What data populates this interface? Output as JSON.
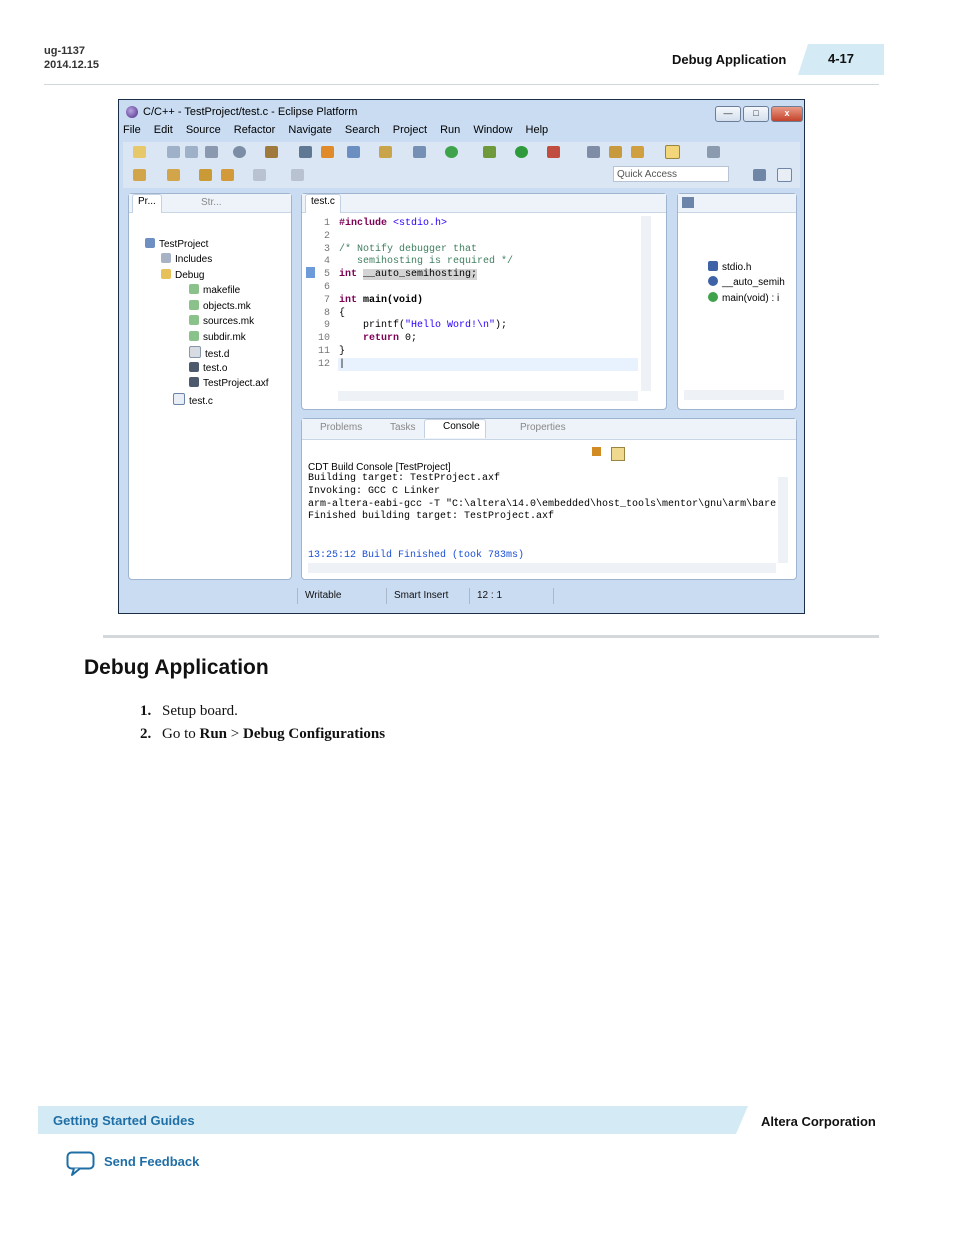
{
  "header": {
    "doc_id": "ug-1137",
    "date": "2014.12.15",
    "section": "Debug Application",
    "page": "4-17"
  },
  "eclipse": {
    "title": "C/C++ - TestProject/test.c - Eclipse Platform",
    "buttons": {
      "minimize": "—",
      "maximize": "□",
      "close": "x"
    },
    "menu": [
      "File",
      "Edit",
      "Source",
      "Refactor",
      "Navigate",
      "Search",
      "Project",
      "Run",
      "Window",
      "Help"
    ],
    "quick_access": "Quick Access",
    "project_tabs": [
      "Pr...",
      "Str..."
    ],
    "tree": [
      {
        "label": "TestProject"
      },
      {
        "label": "Includes"
      },
      {
        "label": "Debug"
      },
      {
        "label": "makefile"
      },
      {
        "label": "objects.mk"
      },
      {
        "label": "sources.mk"
      },
      {
        "label": "subdir.mk"
      },
      {
        "label": "test.d"
      },
      {
        "label": "test.o"
      },
      {
        "label": "TestProject.axf"
      },
      {
        "label": "test.c"
      }
    ],
    "editor_tab": "test.c",
    "code": {
      "l1_kw": "#include",
      "l1_str": "<stdio.h>",
      "l3": "/* Notify debugger that",
      "l4": "   semihosting is required */",
      "l5_kw": "int",
      "l5_rest": "__auto_semihosting;",
      "l7_kw": "int",
      "l7_rest": "main(void)",
      "l8": "{",
      "l9_a": "    printf(",
      "l9_str": "\"Hello Word!\\n\"",
      "l9_b": ");",
      "l10_kw": "    return",
      "l10_rest": " 0;",
      "l11": "}"
    },
    "line_numbers": [
      "1",
      "2",
      "3",
      "4",
      "5",
      "6",
      "7",
      "8",
      "9",
      "10",
      "11",
      "12"
    ],
    "outline": [
      "stdio.h",
      "__auto_semih",
      "main(void) : i"
    ],
    "bottom_tabs": [
      "Problems",
      "Tasks",
      "Console",
      "Properties"
    ],
    "console_title": "CDT Build Console [TestProject]",
    "console_lines": [
      "Building target: TestProject.axf",
      "Invoking: GCC C Linker",
      "arm-altera-eabi-gcc -T \"C:\\altera\\14.0\\embedded\\host_tools\\mentor\\gnu\\arm\\bare",
      "Finished building target: TestProject.axf"
    ],
    "console_finish": "13:25:12 Build Finished (took 783ms)",
    "status": [
      "Writable",
      "Smart Insert",
      "12 : 1"
    ],
    "colors": {
      "keyword": "#7f0055",
      "string": "#2a00ff",
      "comment": "#3f7f5f",
      "console_finish": "#1a4fd6"
    }
  },
  "section_title": "Debug Application",
  "steps": [
    {
      "num": "1.",
      "text": "Setup board."
    },
    {
      "num": "2.",
      "pre": "Go to ",
      "bold1": "Run",
      "sep": " > ",
      "bold2": "Debug Configurations"
    }
  ],
  "footer": {
    "guides": "Getting Started Guides",
    "corp": "Altera Corporation",
    "feedback": "Send Feedback"
  }
}
